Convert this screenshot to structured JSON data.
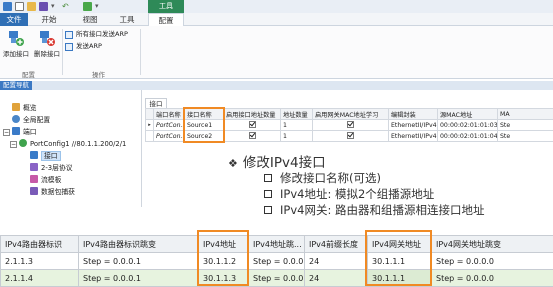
{
  "menu": {
    "file": "文件",
    "start": "开始",
    "view": "视图",
    "tools": "工具",
    "context_tab": "工具",
    "config": "配置"
  },
  "ribbon": {
    "add_port": "添加接口",
    "delete_port": "删除接口",
    "all_ports_send_arp": "所有接口发送ARP",
    "send_arp": "发送ARP",
    "group_config": "配置",
    "group_operations": "操作"
  },
  "nav": {
    "title": "配置导航"
  },
  "tree": {
    "overview": "概览",
    "global_config": "全局配置",
    "port": "端口",
    "port_config": "PortConfig1 //80.1.1.200/2/1",
    "interface": "接口",
    "protocol": "2-3层协议",
    "stream_template": "流模板",
    "capture": "数据包捕获"
  },
  "port_grid": {
    "tab": "接口",
    "columns": [
      "端口名称",
      "接口名称",
      "启用接口地址数量",
      "地址数量",
      "启用网关MAC地址学习",
      "编辑封装",
      "源MAC地址",
      "MA"
    ],
    "rows": [
      {
        "port": "PortCon...",
        "iface": "Source1",
        "enable_count": true,
        "count": "1",
        "gw_learn": true,
        "encap": "EthernetII/IPv4",
        "src_mac": "00:00:02:01:01:03",
        "ma": "Ste"
      },
      {
        "port": "PortCon...",
        "iface": "Source2",
        "enable_count": true,
        "count": "1",
        "gw_learn": true,
        "encap": "EthernetII/IPv4",
        "src_mac": "00:00:02:01:01:04",
        "ma": "Ste"
      }
    ]
  },
  "annotation": {
    "title": "修改IPv4接口",
    "items": [
      "修改接口名称(可选)",
      "IPv4地址: 模拟2个组播源地址",
      "IPv4网关: 路由器和组播源相连接口地址"
    ]
  },
  "ipv4_table": {
    "columns": [
      "IPv4路由器标识",
      "IPv4路由器标识跳变",
      "IPv4地址",
      "IPv4地址跳...",
      "IPv4前缀长度",
      "IPv4网关地址",
      "IPv4网关地址跳变"
    ],
    "rows": [
      [
        "2.1.1.3",
        "Step = 0.0.0.1",
        "30.1.1.2",
        "Step = 0.0.0.1",
        "24",
        "30.1.1.1",
        "Step = 0.0.0.0"
      ],
      [
        "2.1.1.4",
        "Step = 0.0.0.1",
        "30.1.1.3",
        "Step = 0.0.0.1",
        "24",
        "30.1.1.1",
        "Step = 0.0.0.0"
      ]
    ]
  },
  "colors": {
    "highlight": "#f08a24",
    "file_menu": "#2f6fb5",
    "context_tab": "#2e8a58",
    "alt_row": "#e7f3df"
  }
}
